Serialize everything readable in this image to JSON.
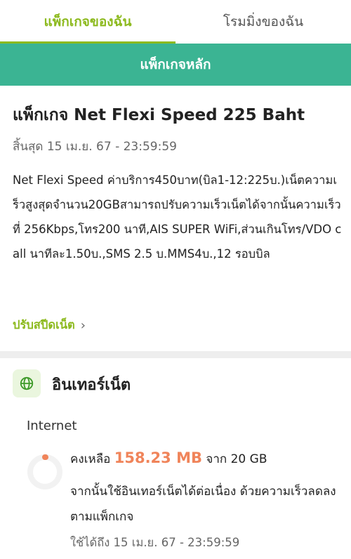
{
  "tabs": [
    {
      "label": "แพ็กเกจของฉัน",
      "active": true
    },
    {
      "label": "โรมมิ่งของฉัน",
      "active": false
    }
  ],
  "banner": {
    "label": "แพ็กเกจหลัก"
  },
  "package": {
    "title": "แพ็กเกจ Net Flexi Speed 225 Baht",
    "expiry": "สิ้นสุด 15 เม.ย. 67 - 23:59:59",
    "description": "Net Flexi Speed ค่าบริการ450บาท(บิล1-12:225บ.)เน็ตความเร็วสูงสุดจำนวน20GBสามารถปรับความเร็วเน็ตได้จากนั้นความเร็วที่ 256Kbps,โทร200 นาที,AIS SUPER WiFi,ส่วนเกินโทร/VDO call นาทีละ1.50บ.,SMS 2.5 บ.MMS4บ.,12 รอบบิล",
    "adjust_link": "ปรับสปีดเน็ต",
    "adjust_chevron": "›"
  },
  "internet": {
    "section_title": "อินเทอร์เน็ต",
    "section_icon": "globe-icon",
    "label": "Internet",
    "remaining_prefix": "คงเหลือ",
    "remaining_amount": "158.23 MB",
    "remaining_suffix": "จาก 20 GB",
    "remaining_fraction": 0.0079,
    "after_text": "จากนั้นใช้อินเทอร์เน็ตได้ต่อเนื่อง ด้วยความเร็วลดลงตามแพ็กเกจ",
    "valid_until": "ใช้ได้ถึง 15 เม.ย. 67 - 23:59:59"
  },
  "colors": {
    "accent_green": "#8dba1f",
    "banner_teal": "#3bb493",
    "amount_orange": "#f0845a"
  }
}
